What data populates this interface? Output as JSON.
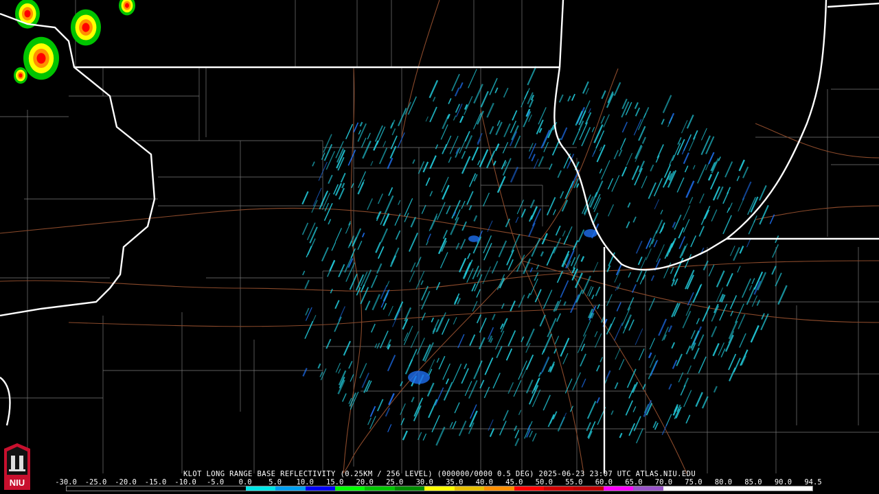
{
  "title": "KLOT LONG RANGE BASE REFLECTIVITY (0.25KM / 256 LEVEL) (000000/0000 0.5 DEG) 2025-06-23 23:07 UTC  ATLAS.NIU.EDU",
  "logo_text": "NIU",
  "colorbar": {
    "ticks": [
      "-30.0",
      "-25.0",
      "-20.0",
      "-15.0",
      "-10.0",
      "-5.0",
      "0.0",
      "5.0",
      "10.0",
      "15.0",
      "20.0",
      "25.0",
      "30.0",
      "35.0",
      "40.0",
      "45.0",
      "50.0",
      "55.0",
      "60.0",
      "65.0",
      "70.0",
      "75.0",
      "80.0",
      "85.0",
      "90.0",
      "94.5"
    ],
    "colors": [
      "#000000",
      "#000000",
      "#000000",
      "#000000",
      "#000000",
      "#000000",
      "#00e5e5",
      "#009ff0",
      "#0000f5",
      "#00ff00",
      "#00c400",
      "#008c00",
      "#ffff00",
      "#e7bf00",
      "#ff9000",
      "#ff0000",
      "#d00000",
      "#c00000",
      "#ff00ff",
      "#9955c9",
      "#ffffff",
      "#ffffff",
      "#ffffff",
      "#ffffff",
      "#ffffff"
    ]
  },
  "legend_colors": {
    "state_border": "#ffffff",
    "county_line": "#7a7a7a",
    "highway": "#8b4a2b",
    "echo_light": "#22c8d8",
    "echo_medium": "#1e6ff0"
  }
}
